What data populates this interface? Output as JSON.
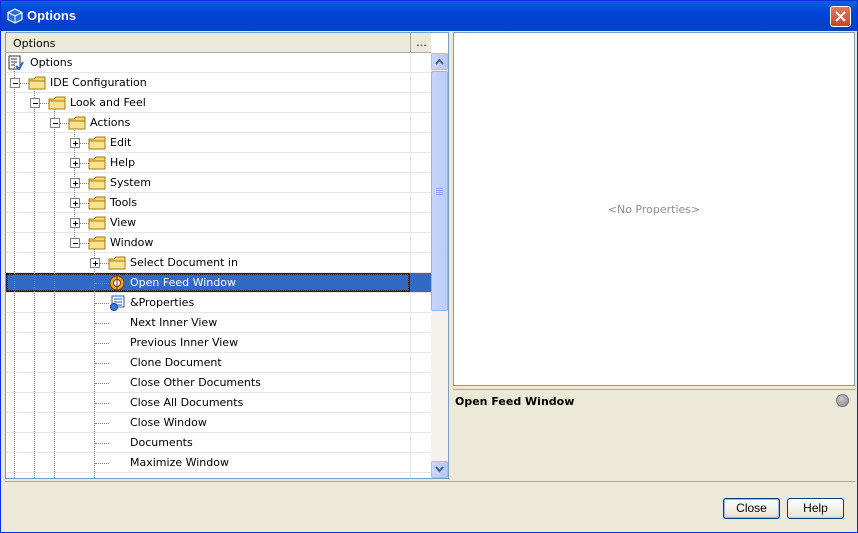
{
  "window": {
    "title": "Options",
    "icon": "netbeans-cube-icon"
  },
  "left_pane": {
    "header": {
      "column_label": "Options",
      "more_button_label": "..."
    },
    "tree": [
      {
        "label": "Options",
        "icon": "options-root-icon"
      },
      {
        "label": "IDE Configuration",
        "icon": "folder-icon",
        "expanded": true
      },
      {
        "label": "Look and Feel",
        "icon": "folder-icon",
        "expanded": true
      },
      {
        "label": "Actions",
        "icon": "folder-icon",
        "expanded": true
      },
      {
        "label": "Edit",
        "icon": "folder-icon",
        "expanded": false
      },
      {
        "label": "Help",
        "icon": "folder-icon",
        "expanded": false
      },
      {
        "label": "System",
        "icon": "folder-icon",
        "expanded": false
      },
      {
        "label": "Tools",
        "icon": "folder-icon",
        "expanded": false
      },
      {
        "label": "View",
        "icon": "folder-icon",
        "expanded": false
      },
      {
        "label": "Window",
        "icon": "folder-icon",
        "expanded": true
      },
      {
        "label": "Select Document in",
        "icon": "folder-icon",
        "expanded": false
      },
      {
        "label": "Open Feed Window",
        "icon": "feed-action-icon",
        "selected": true
      },
      {
        "label": "&Properties",
        "icon": "properties-action-icon"
      },
      {
        "label": "Next Inner View"
      },
      {
        "label": "Previous Inner View"
      },
      {
        "label": "Clone Document"
      },
      {
        "label": "Close Other Documents"
      },
      {
        "label": "Close All Documents"
      },
      {
        "label": "Close Window"
      },
      {
        "label": "Documents"
      },
      {
        "label": "Maximize Window"
      }
    ]
  },
  "right_pane": {
    "empty_message": "<No Properties>",
    "description": {
      "title": "Open Feed Window"
    }
  },
  "buttons": {
    "close": "Close",
    "help": "Help"
  },
  "colors": {
    "selection": "#316ac5",
    "titlebar": "#0a50d8",
    "panel_bg": "#ece9d8"
  }
}
